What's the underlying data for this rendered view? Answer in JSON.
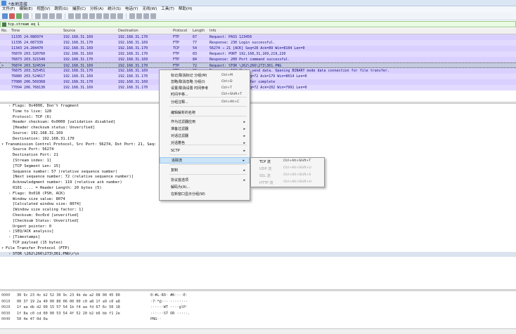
{
  "window": {
    "title": "*本地连接"
  },
  "menubar": [
    "文件(F)",
    "编辑(E)",
    "视图(V)",
    "跳转(G)",
    "捕获(C)",
    "分析(A)",
    "统计(S)",
    "电话(Y)",
    "无线(W)",
    "工具(T)",
    "帮助(H)"
  ],
  "filter": {
    "value": "tcp.stream eq 1"
  },
  "packet_list": {
    "columns": [
      "No.",
      "Time",
      "Source",
      "Destination",
      "Protocol",
      "Length",
      "Info"
    ],
    "rows": [
      [
        "",
        "11335 24.086974",
        "192.168.31.169",
        "192.168.31.170",
        "FTP",
        "67",
        "Request: PASS 123456"
      ],
      [
        "",
        "11336 24.087339",
        "192.168.31.170",
        "192.168.31.169",
        "FTP",
        "77",
        "Response: 230 Login successful."
      ],
      [
        "",
        "11343 24.284470",
        "192.168.31.169",
        "192.168.31.170",
        "TCP",
        "54",
        "56274 → 21 [ACK] Seq=28 Ack=89 Win=8104 Len=0"
      ],
      [
        "",
        "76870 203.320760",
        "192.168.31.169",
        "192.168.31.170",
        "FTP",
        "83",
        "Request: PORT 192,168,31,169,219,220"
      ],
      [
        "",
        "76873 203.321549",
        "192.168.31.170",
        "192.168.31.169",
        "FTP",
        "84",
        "Response: 200 Port command successful."
      ],
      [
        ">",
        "76874 203.324534",
        "192.168.31.169",
        "192.168.31.170",
        "FTP",
        "72",
        "Request: STOR \\262\\266\\273\\361.PNG"
      ],
      [
        "",
        "76875 203.325451",
        "192.168.31.170",
        "192.168.31.169",
        "FTP",
        "95",
        "Response: 150 Ok to send data. Opening BINARY mode data connection for file transfer."
      ],
      [
        "",
        "76880 203.524617",
        "192.168.31.169",
        "192.168.31.170",
        "TCP",
        "54",
        "56274 → 21 [ACK] Seq=72 Ack=179 Win=8014 Len=0"
      ],
      [
        "",
        "77080 206.569368",
        "192.168.31.170",
        "192.168.31.169",
        "FTP",
        "78",
        "Response: 226 Transfer complete"
      ],
      [
        "",
        "77094 206.768130",
        "192.168.31.169",
        "192.168.31.170",
        "TCP",
        "54",
        "56274 → 21 [ACK] Seq=72 Ack=202 Win=7991 Len=0"
      ]
    ]
  },
  "details": [
    {
      "t": ">",
      "text": "Flags: 0x4000, Don't fragment",
      "indent": 1
    },
    {
      "t": "",
      "text": "Time to live: 128",
      "indent": 1
    },
    {
      "t": "",
      "text": "Protocol: TCP (6)",
      "indent": 1
    },
    {
      "t": "",
      "text": "Header checksum: 0x0000 [validation disabled]",
      "indent": 1
    },
    {
      "t": "",
      "text": "[Header checksum status: Unverified]",
      "indent": 1
    },
    {
      "t": "",
      "text": "Source: 192.168.31.169",
      "indent": 1
    },
    {
      "t": "",
      "text": "Destination: 192.168.31.170",
      "indent": 1
    },
    {
      "t": "v",
      "text": "Transmission Control Protocol, Src Port: 56274, Dst Port: 21, Seq: 57, Ack: 119, Len: 18",
      "indent": 0
    },
    {
      "t": "",
      "text": "Source Port: 56274",
      "indent": 1
    },
    {
      "t": "",
      "text": "Destination Port: 21",
      "indent": 1
    },
    {
      "t": "",
      "text": "[Stream index: 1]",
      "indent": 1
    },
    {
      "t": "",
      "text": "[TCP Segment Len: 15]",
      "indent": 1
    },
    {
      "t": "",
      "text": "Sequence number: 57    (relative sequence number)",
      "indent": 1
    },
    {
      "t": "",
      "text": "[Next sequence number: 72    (relative sequence number)]",
      "indent": 1
    },
    {
      "t": "",
      "text": "Acknowledgment number: 119    (relative ack number)",
      "indent": 1
    },
    {
      "t": "",
      "text": "0101 .... = Header Length: 20 bytes (5)",
      "indent": 1
    },
    {
      "t": ">",
      "text": "Flags: 0x018 (PSH, ACK)",
      "indent": 1
    },
    {
      "t": "",
      "text": "Window size value: 8074",
      "indent": 1
    },
    {
      "t": "",
      "text": "[Calculated window size: 8074]",
      "indent": 1
    },
    {
      "t": "",
      "text": "[Window size scaling factor: 1]",
      "indent": 1
    },
    {
      "t": "",
      "text": "Checksum: 0xc0cd [unverified]",
      "indent": 1
    },
    {
      "t": "",
      "text": "[Checksum Status: Unverified]",
      "indent": 1
    },
    {
      "t": "",
      "text": "Urgent pointer: 0",
      "indent": 1
    },
    {
      "t": ">",
      "text": "[SEQ/ACK analysis]",
      "indent": 1
    },
    {
      "t": ">",
      "text": "[Timestamps]",
      "indent": 1
    },
    {
      "t": "",
      "text": "TCP payload (15 bytes)",
      "indent": 1
    },
    {
      "t": "v",
      "text": "File Transfer Protocol (FTP)",
      "indent": 0
    },
    {
      "t": ">",
      "text": "STOR \\262\\266\\273\\361.PNG\\r\\n",
      "indent": 1
    }
  ],
  "bytes": [
    {
      "off": "0000",
      "hex": "30 9c 23 4c b2 52 30 9c  23 4b de a2 08 00 45 00",
      "ascii": "0·#L·R0· #K····E·"
    },
    {
      "off": "0010",
      "hex": "00 37 19 2a 40 00 80 06  00 00 c0 a8 1f a9 c0 a8",
      "ascii": "·7·*@··· ········"
    },
    {
      "off": "0020",
      "hex": "1f aa db d2 00 15 57 54  1b f4 aa fd 67 6c 50 18",
      "ascii": "······WT ····glP·"
    },
    {
      "off": "0030",
      "hex": "1f 8a c0 cd 00 00 53 54  4f 52 20 b2 b6 bb f1 2e",
      "ascii": "······ST OR ·····."
    },
    {
      "off": "0040",
      "hex": "50 4e 47 0d 0a",
      "ascii": "PNG··"
    }
  ],
  "context_menu": {
    "items": [
      {
        "label": "标记/取消标记 分组(M)",
        "shortcut": "Ctrl+M",
        "arrow": false
      },
      {
        "label": "忽略/取消忽略 分组(I)",
        "shortcut": "Ctrl+D",
        "arrow": false
      },
      {
        "label": "设置/取消设置 时间参考",
        "shortcut": "Ctrl+T",
        "arrow": false
      },
      {
        "label": "时间平移...",
        "shortcut": "Ctrl+Shift+T",
        "arrow": false
      },
      {
        "label": "分组注释...",
        "shortcut": "Ctrl+Alt+C",
        "arrow": false
      },
      {
        "label": "编辑解析的名称",
        "shortcut": "",
        "arrow": false
      },
      {
        "label": "作为过滤器应用",
        "shortcut": "",
        "arrow": true
      },
      {
        "label": "准备过滤器",
        "shortcut": "",
        "arrow": true
      },
      {
        "label": "对话过滤器",
        "shortcut": "",
        "arrow": true
      },
      {
        "label": "对话着色",
        "shortcut": "",
        "arrow": true
      },
      {
        "label": "SCTP",
        "shortcut": "",
        "arrow": true
      },
      {
        "label": "追踪流",
        "shortcut": "",
        "arrow": true
      },
      {
        "label": "复制",
        "shortcut": "",
        "arrow": true
      },
      {
        "label": "协议首选项",
        "shortcut": "",
        "arrow": true
      },
      {
        "label": "解码为(A)...",
        "shortcut": "",
        "arrow": false
      },
      {
        "label": "在新窗口显示分组(W)",
        "shortcut": "",
        "arrow": false
      }
    ]
  },
  "submenu": {
    "items": [
      {
        "label": "TCP 流",
        "shortcut": "Ctrl+Alt+Shift+T",
        "enabled": true
      },
      {
        "label": "UDP 流",
        "shortcut": "Ctrl+Alt+Shift+U",
        "enabled": false
      },
      {
        "label": "SSL 流",
        "shortcut": "Ctrl+Alt+Shift+S",
        "enabled": false
      },
      {
        "label": "HTTP 流",
        "shortcut": "Ctrl+Alt+Shift+H",
        "enabled": false
      }
    ]
  }
}
